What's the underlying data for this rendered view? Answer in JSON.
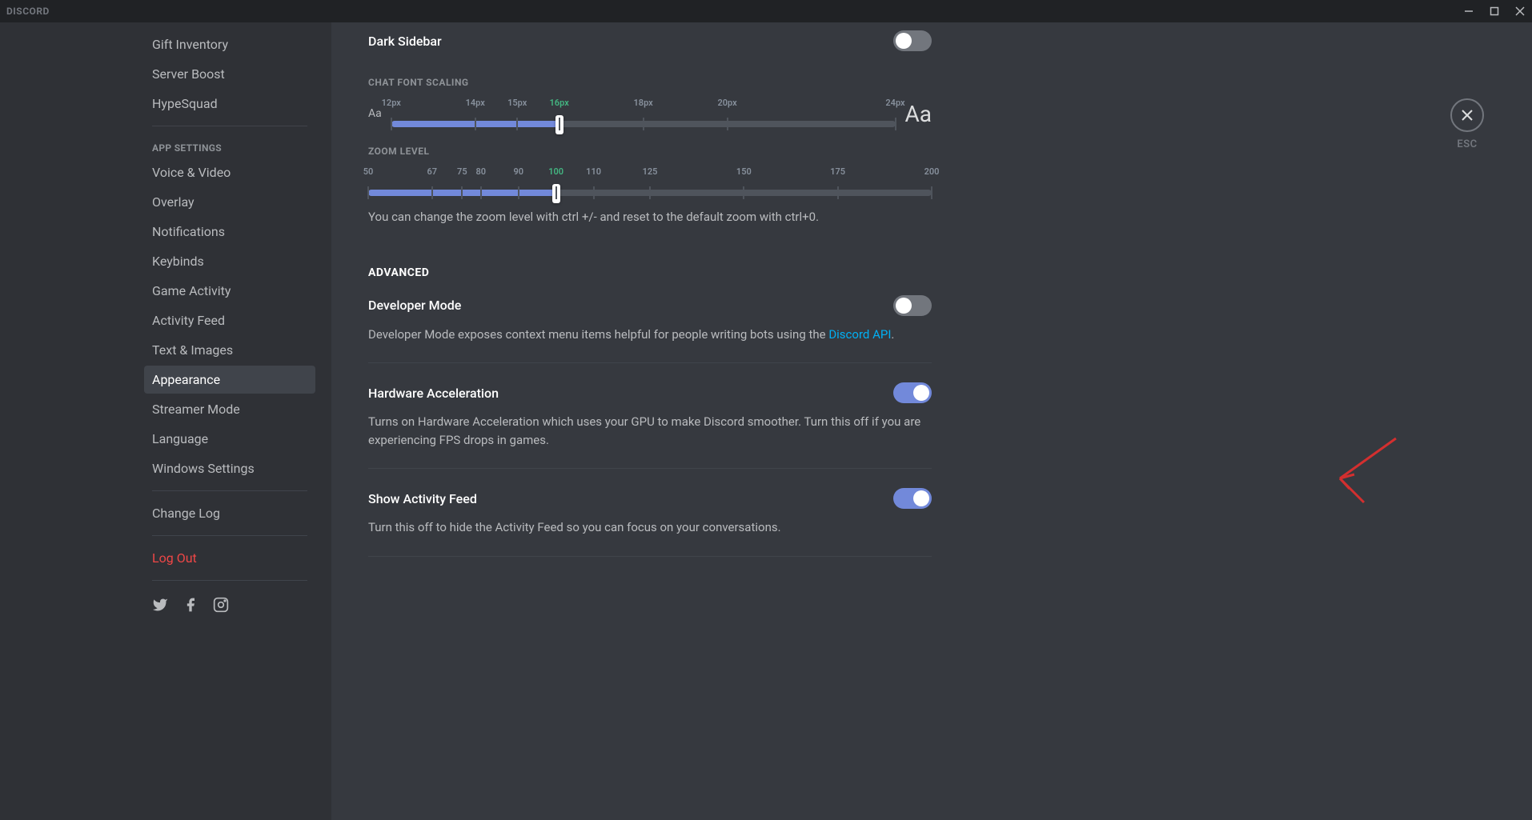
{
  "app": {
    "title": "DISCORD"
  },
  "close": {
    "label": "ESC"
  },
  "sidebar": {
    "items_top": [
      {
        "label": "Gift Inventory"
      },
      {
        "label": "Server Boost"
      },
      {
        "label": "HypeSquad"
      }
    ],
    "header_app": "APP SETTINGS",
    "items_app": [
      {
        "label": "Voice & Video"
      },
      {
        "label": "Overlay"
      },
      {
        "label": "Notifications"
      },
      {
        "label": "Keybinds"
      },
      {
        "label": "Game Activity"
      },
      {
        "label": "Activity Feed"
      },
      {
        "label": "Text & Images"
      },
      {
        "label": "Appearance",
        "active": true
      },
      {
        "label": "Streamer Mode"
      },
      {
        "label": "Language"
      },
      {
        "label": "Windows Settings"
      }
    ],
    "items_bottom": [
      {
        "label": "Change Log"
      }
    ],
    "logout": "Log Out"
  },
  "settings": {
    "dark_sidebar": {
      "title": "Dark Sidebar",
      "on": false
    },
    "chat_font": {
      "header": "CHAT FONT SCALING",
      "small": "Aa",
      "large": "Aa",
      "ticks": [
        "12px",
        "14px",
        "15px",
        "16px",
        "18px",
        "20px",
        "24px"
      ],
      "positions": [
        0,
        16.67,
        25,
        33.33,
        50,
        66.67,
        100
      ],
      "active_index": 3,
      "fill_percent": 33.33
    },
    "zoom": {
      "header": "ZOOM LEVEL",
      "ticks": [
        "50",
        "67",
        "75",
        "80",
        "90",
        "100",
        "110",
        "125",
        "150",
        "175",
        "200"
      ],
      "positions": [
        0,
        11.33,
        16.67,
        20,
        26.67,
        33.33,
        40,
        50,
        66.67,
        83.33,
        100
      ],
      "active_index": 5,
      "fill_percent": 33.33,
      "desc": "You can change the zoom level with ctrl +/- and reset to the default zoom with ctrl+0."
    },
    "advanced_header": "ADVANCED",
    "dev_mode": {
      "title": "Developer Mode",
      "desc_before": "Developer Mode exposes context menu items helpful for people writing bots using the ",
      "link": "Discord API",
      "desc_after": ".",
      "on": false
    },
    "hw_accel": {
      "title": "Hardware Acceleration",
      "desc": "Turns on Hardware Acceleration which uses your GPU to make Discord smoother. Turn this off if you are experiencing FPS drops in games.",
      "on": true
    },
    "activity_feed": {
      "title": "Show Activity Feed",
      "desc": "Turn this off to hide the Activity Feed so you can focus on your conversations.",
      "on": true
    }
  }
}
